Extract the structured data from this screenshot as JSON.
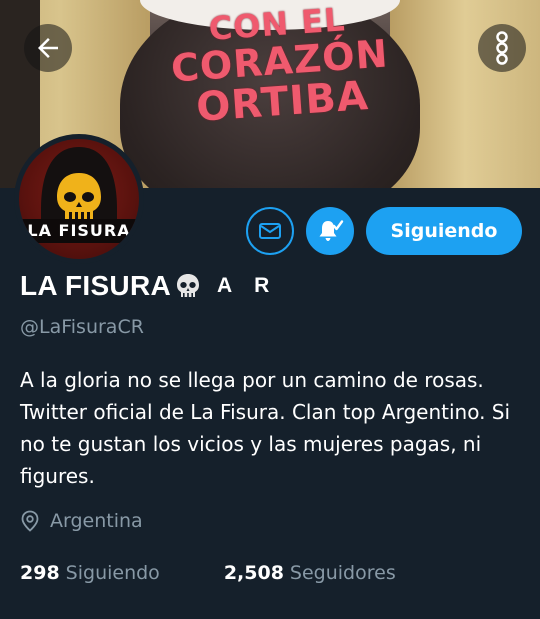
{
  "banner": {
    "line1": "CON EL",
    "line2": "CORAZÓN",
    "line3": "ORTIBA"
  },
  "header": {
    "back_icon": "arrow-left-icon",
    "more_icon": "more-vertical-icon"
  },
  "avatar": {
    "label": "LA FISURA"
  },
  "actions": {
    "message_icon": "mail-icon",
    "notifications_icon": "bell-check-icon",
    "follow_label": "Siguiendo"
  },
  "profile": {
    "display_name": "LA FISURA",
    "name_emoji": "skull-icon",
    "flag_letters": [
      "A",
      "R"
    ],
    "handle": "@LaFisuraCR",
    "bio": "A la gloria no se llega por un camino de rosas. Twitter oficial de La Fisura. Clan top Argentino. Si no te gustan los vicios y las mujeres pagas, ni figures.",
    "location": "Argentina",
    "following_count": "298",
    "following_label": "Siguiendo",
    "followers_count": "2,508",
    "followers_label": "Seguidores"
  },
  "colors": {
    "background": "#15202b",
    "accent": "#1da1f2",
    "secondary_text": "#8899a6",
    "banner_text": "#ef5a6e"
  }
}
